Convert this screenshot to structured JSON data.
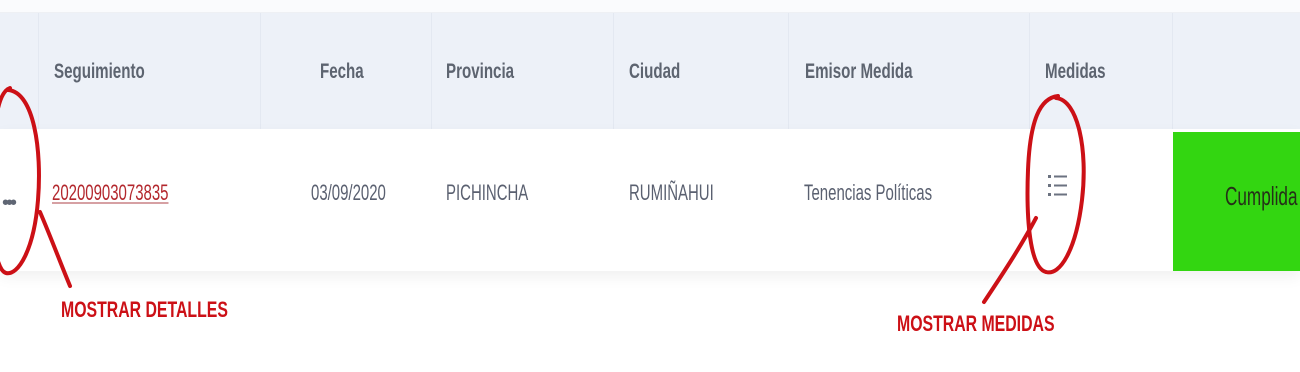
{
  "table": {
    "headers": {
      "seguimiento": "Seguimiento",
      "fecha": "Fecha",
      "provincia": "Provincia",
      "ciudad": "Ciudad",
      "emisor": "Emisor Medida",
      "medidas": "Medidas"
    },
    "rows": [
      {
        "details_icon": "more-dots-icon",
        "seguimiento": "20200903073835",
        "fecha": "03/09/2020",
        "provincia": "PICHINCHA",
        "ciudad": "RUMIÑAHUI",
        "emisor": "Tenencias Políticas",
        "medidas_icon": "list-icon",
        "estado": "Cumplida"
      }
    ]
  },
  "annotations": {
    "details": "MOSTRAR DETALLES",
    "medidas": "MOSTRAR MEDIDAS"
  },
  "colors": {
    "header_bg": "#edf1f8",
    "link": "#b3272d",
    "status_done": "#33d611",
    "annotation": "#cc1016"
  }
}
